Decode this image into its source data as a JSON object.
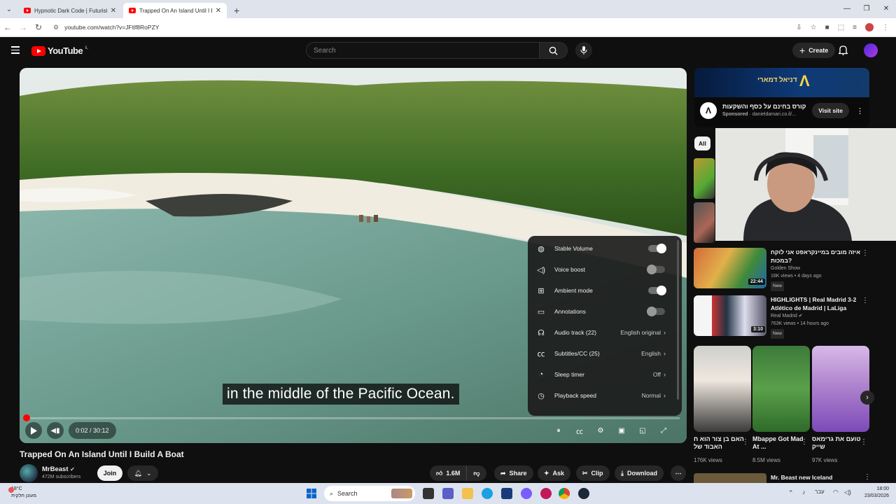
{
  "browser": {
    "tabs": [
      {
        "title": "Hypnotic Dark Code | Futuristic"
      },
      {
        "title": "Trapped On An Island Until I Bu"
      }
    ],
    "url": "youtube.com/watch?v=JFtlf8RoPZY"
  },
  "header": {
    "logo_text": "YouTube",
    "logo_suffix": "IL",
    "search_placeholder": "Search",
    "create_label": "Create"
  },
  "player": {
    "caption": "in the middle of the Pacific Ocean.",
    "time": "0:02 / 30:12",
    "progress": 0.001
  },
  "settings": {
    "items": [
      {
        "label": "Stable Volume",
        "toggle": "on"
      },
      {
        "label": "Voice boost",
        "toggle": "off"
      },
      {
        "label": "Ambient mode",
        "toggle": "on"
      },
      {
        "label": "Annotations",
        "toggle": "off"
      },
      {
        "label": "Audio track (22)",
        "value": "English original"
      },
      {
        "label": "Subtitles/CC (25)",
        "value": "English"
      },
      {
        "label": "Sleep timer",
        "value": "Off"
      },
      {
        "label": "Playback speed",
        "value": "Normal"
      }
    ]
  },
  "video": {
    "title": "Trapped On An Island Until I Build A Boat",
    "channel": "MrBeast",
    "subscribers": "472M subscribers",
    "join_label": "Join",
    "likes": "1.6M",
    "share_label": "Share",
    "ask_label": "Ask",
    "clip_label": "Clip",
    "download_label": "Download"
  },
  "ad": {
    "title": "קורס בחינם על כסף והשקעות",
    "sponsored": "Sponsored",
    "domain": "danieldamari.co.il/...",
    "banner_text": "דניאל דמארי",
    "visit_label": "Visit site"
  },
  "chips": {
    "all": "All"
  },
  "recommendations": [
    {
      "title": "איזה מובים במיינקראפט אני לוקח במכות?",
      "channel": "Golden Show",
      "meta": "16K views • 4 days ago",
      "badge": "New",
      "duration": "22:44"
    },
    {
      "title": "HIGHLIGHTS | Real Madrid 3-2 Atlético de Madrid | LaLiga",
      "channel": "Real Madrid",
      "meta": "763K views • 14 hours ago",
      "badge": "New",
      "duration": "3:10"
    }
  ],
  "shorts": [
    {
      "title": "האם בן צור הוא ח האבוד של",
      "views": "176K views"
    },
    {
      "title": "Mbappe Got Mad At ...",
      "views": "8.5M views"
    },
    {
      "title": "טועם את גרימאס שייק",
      "views": "97K views"
    }
  ],
  "next_rec": {
    "title": "Mr. Beast new Iceland"
  },
  "taskbar": {
    "temp": "18°C",
    "weather": "מעונן חלקית",
    "search": "Search",
    "lang": "עבר",
    "time": "18:00",
    "date": "23/03/2026"
  }
}
